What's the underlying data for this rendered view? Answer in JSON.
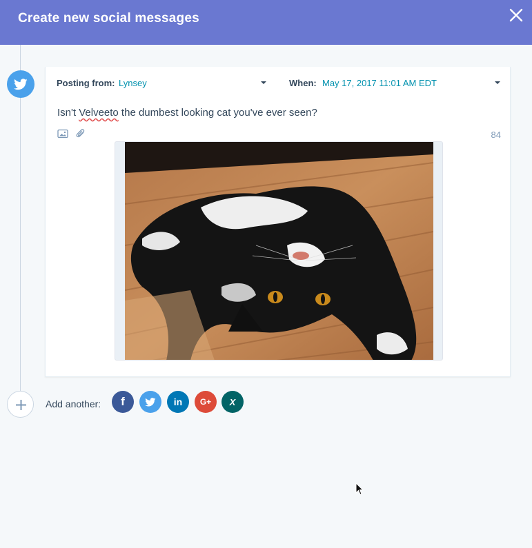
{
  "header": {
    "title": "Create new social messages",
    "close_icon": "close-icon"
  },
  "post": {
    "network_icon": "twitter-icon",
    "posting_from_label": "Posting from:",
    "posting_from_value": "Lynsey",
    "when_label": "When:",
    "when_value": "May 17, 2017 11:01 AM EDT",
    "message_before": "Isn't ",
    "message_misspelled": "Velveeto",
    "message_after": " the dumbest looking cat you've ever seen?",
    "character_count": "84",
    "toolbar_icons": [
      "image-icon",
      "paperclip-icon"
    ]
  },
  "add_another": {
    "label": "Add another:",
    "networks": [
      {
        "name": "facebook",
        "glyph": "f",
        "color": "#3b5998"
      },
      {
        "name": "twitter",
        "glyph": "",
        "color": "#4aa1eb"
      },
      {
        "name": "linkedin",
        "glyph": "in",
        "color": "#0077b5"
      },
      {
        "name": "google-plus",
        "glyph": "G+",
        "color": "#dd4b39"
      },
      {
        "name": "xing",
        "glyph": "X",
        "color": "#026466"
      }
    ]
  },
  "colors": {
    "header": "#6a78d1",
    "link": "#0091ae",
    "timeline": "#cbd6e2",
    "background": "#f5f8fa"
  }
}
